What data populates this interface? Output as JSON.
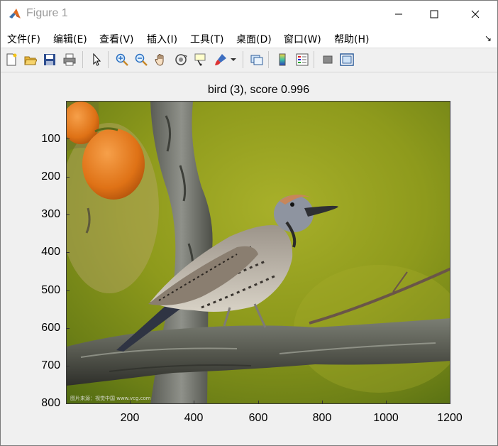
{
  "window": {
    "title": "Figure 1"
  },
  "menu": {
    "items": [
      {
        "label": "文件(F)"
      },
      {
        "label": "编辑(E)"
      },
      {
        "label": "查看(V)"
      },
      {
        "label": "插入(I)"
      },
      {
        "label": "工具(T)"
      },
      {
        "label": "桌面(D)"
      },
      {
        "label": "窗口(W)"
      },
      {
        "label": "帮助(H)"
      }
    ]
  },
  "toolbar": {
    "icons": [
      "new-figure-icon",
      "open-file-icon",
      "save-icon",
      "print-icon",
      "pointer-icon",
      "zoom-in-icon",
      "zoom-out-icon",
      "pan-hand-icon",
      "rotate-3d-icon",
      "data-cursor-icon",
      "brush-icon",
      "link-plot-icon",
      "colorbar-icon",
      "legend-icon",
      "hide-plot-tools-icon",
      "show-plot-tools-icon"
    ]
  },
  "plot": {
    "title": "bird (3), score 0.996",
    "y_ticks": [
      "100",
      "200",
      "300",
      "400",
      "500",
      "600",
      "700",
      "800"
    ],
    "x_ticks": [
      "200",
      "400",
      "600",
      "800",
      "1000",
      "1200"
    ],
    "watermark": "图片来源：视觉中国 www.vcg.com"
  },
  "colors": {
    "background_green": "#8a9a1a",
    "branch_gray": "#6b6e66",
    "persimmon_orange": "#e07a1c"
  }
}
